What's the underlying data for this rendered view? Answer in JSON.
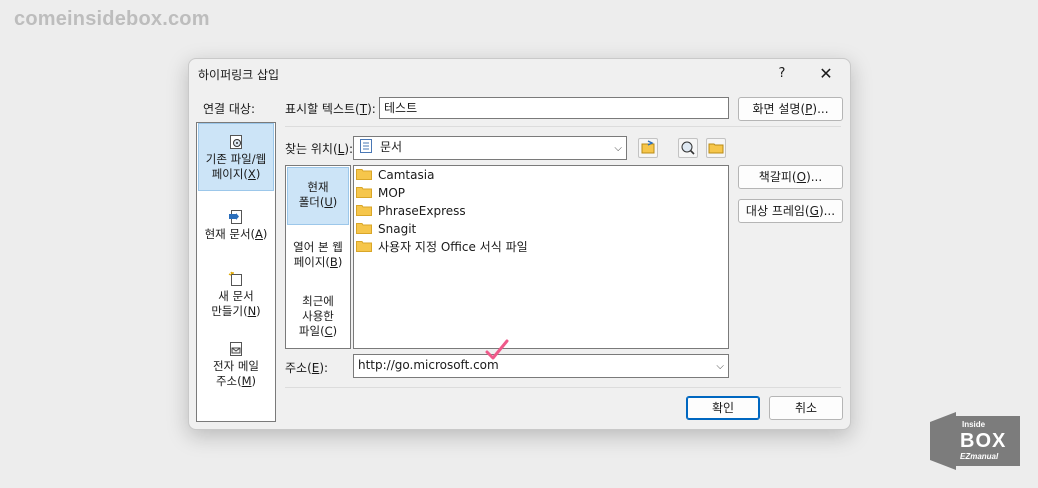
{
  "watermark": "comeinsidebox.com",
  "logo": {
    "line1": "Inside",
    "line2": "BOX",
    "line3": "EZmanual"
  },
  "dialog": {
    "title": "하이퍼링크 삽입",
    "help": "?",
    "close": "✕"
  },
  "link_to": {
    "label": "연결 대상:",
    "items": [
      {
        "line1": "기존 파일/웹",
        "line2_pre": "페이지(",
        "key": "X",
        "line2_post": ")",
        "icon": "web-page-icon",
        "selected": true
      },
      {
        "line1": "현재 문서(",
        "key": "A",
        "line1_post": ")",
        "icon": "document-place-icon"
      },
      {
        "line1": "새 문서",
        "line2_pre": "만들기(",
        "key": "N",
        "line2_post": ")",
        "icon": "new-document-icon"
      },
      {
        "line1": "전자 메일",
        "line2_pre": "주소(",
        "key": "M",
        "line2_post": ")",
        "icon": "email-icon"
      }
    ]
  },
  "text_to_display": {
    "label_pre": "표시할 텍스트(",
    "key": "T",
    "label_post": "):",
    "value": "테스트"
  },
  "screentip_button": {
    "pre": "화면 설명(",
    "key": "P",
    "post": ")..."
  },
  "look_in": {
    "label_pre": "찾는 위치(",
    "key": "L",
    "label_post": "):",
    "value": "문서",
    "icon": "documents-icon"
  },
  "places": [
    {
      "line1": "현재",
      "line2_pre": "폴더(",
      "key": "U",
      "line2_post": ")",
      "selected": true
    },
    {
      "line1": "열어 본 웹",
      "line2_pre": "페이지(",
      "key": "B",
      "line2_post": ")"
    },
    {
      "line1": "최근에",
      "line2": "사용한",
      "line3_pre": "파일(",
      "key": "C",
      "line3_post": ")"
    }
  ],
  "files": [
    "Camtasia",
    "MOP",
    "PhraseExpress",
    "Snagit",
    "사용자 지정 Office 서식 파일"
  ],
  "bookmark_button": {
    "pre": "책갈피(",
    "key": "O",
    "post": ")..."
  },
  "target_frame_button": {
    "pre": "대상 프레임(",
    "key": "G",
    "post": ")..."
  },
  "address": {
    "label_pre": "주소(",
    "key": "E",
    "label_post": "):",
    "value": "http://go.microsoft.com"
  },
  "ok_button": "확인",
  "cancel_button": "취소",
  "colors": {
    "accent": "#0067c0",
    "selection": "#cce4f7",
    "folder": "#f6c64b",
    "checkmark": "#ef5a8a"
  }
}
